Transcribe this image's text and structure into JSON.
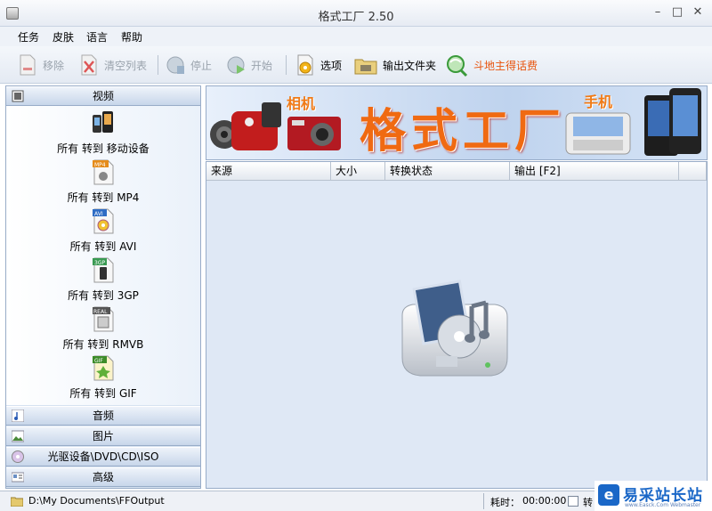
{
  "window": {
    "title": "格式工厂 2.50",
    "min": "–",
    "max": "□",
    "close": "✕"
  },
  "menu": [
    "任务",
    "皮肤",
    "语言",
    "帮助"
  ],
  "toolbar": {
    "remove": "移除",
    "clear": "清空列表",
    "stop": "停止",
    "start": "开始",
    "options": "选项",
    "output_folder": "输出文件夹",
    "promo": "斗地主得话费"
  },
  "sidebar": {
    "video": "视频",
    "formats": [
      {
        "badge": "",
        "label": "所有 转到 移动设备"
      },
      {
        "badge": "MP4",
        "label": "所有 转到 MP4"
      },
      {
        "badge": "AVI",
        "label": "所有 转到 AVI"
      },
      {
        "badge": "3GP",
        "label": "所有 转到 3GP"
      },
      {
        "badge": "REAL",
        "label": "所有 转到 RMVB"
      },
      {
        "badge": "GIF",
        "label": "所有 转到 GIF"
      }
    ],
    "audio": "音频",
    "picture": "图片",
    "rom": "光驱设备\\DVD\\CD\\ISO",
    "advanced": "高级"
  },
  "banner": {
    "title": "格式工厂",
    "camera": "相机",
    "phone": "手机"
  },
  "filelist": {
    "columns": [
      "来源",
      "大小",
      "转换状态",
      "输出 [F2]"
    ]
  },
  "status": {
    "path": "D:\\My Documents\\FFOutput",
    "time_label": "耗时：",
    "time": "00:00:00",
    "check_label": "转"
  },
  "watermark": {
    "logo": "e",
    "title": "易采站长站",
    "url": "www.Easck.Com  Webmaster"
  }
}
